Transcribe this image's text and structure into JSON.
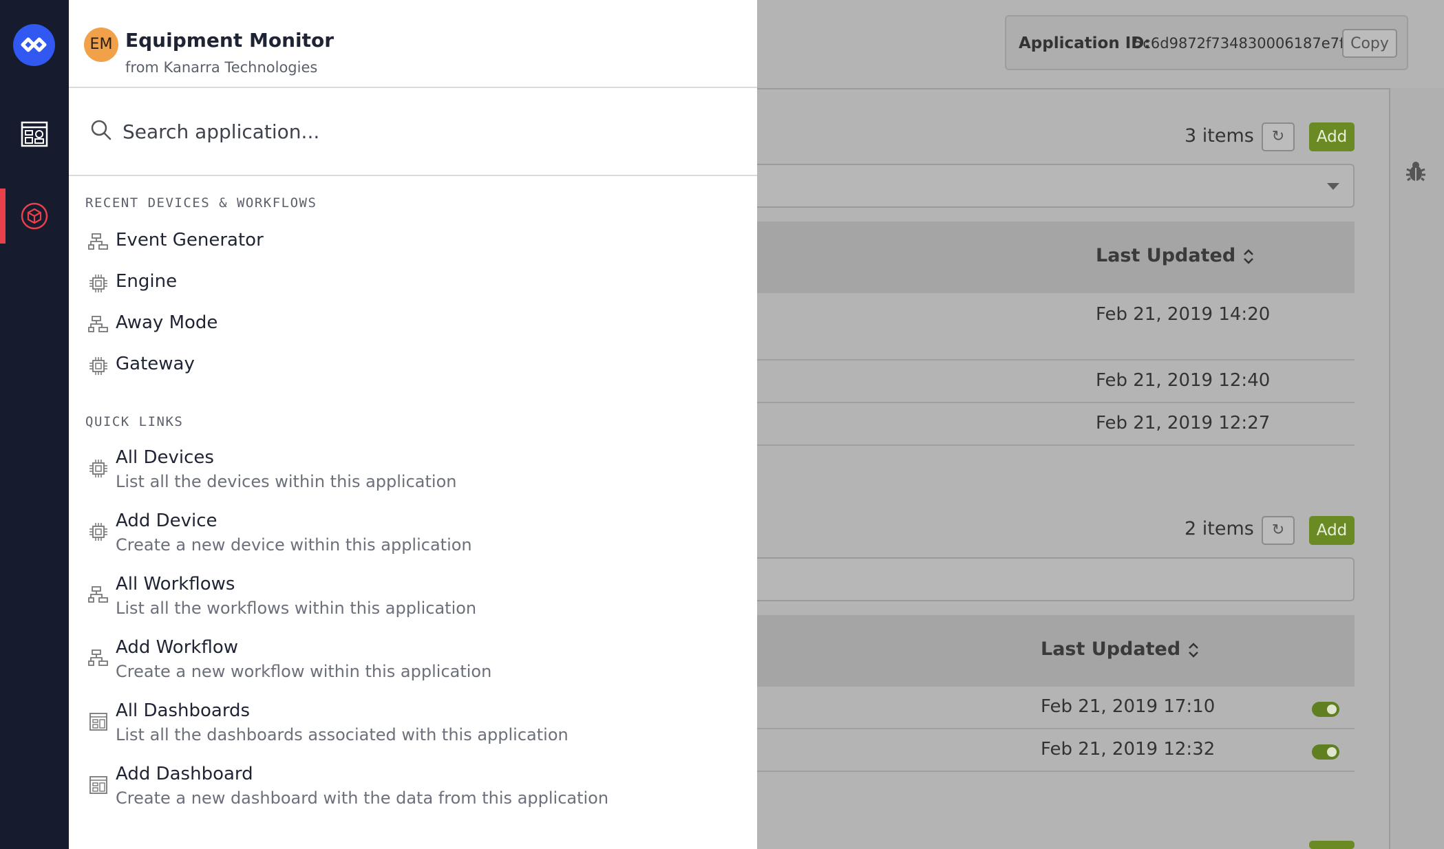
{
  "app": {
    "initials": "EM",
    "name": "Equipment Monitor",
    "org": "from Kanarra Technologies"
  },
  "search": {
    "placeholder": "Search application..."
  },
  "recent": {
    "title": "RECENT DEVICES & WORKFLOWS",
    "items": [
      {
        "label": "Event Generator",
        "icon": "workflow-icon"
      },
      {
        "label": "Engine",
        "icon": "device-chip-icon"
      },
      {
        "label": "Away Mode",
        "icon": "workflow-icon"
      },
      {
        "label": "Gateway",
        "icon": "device-chip-icon"
      }
    ]
  },
  "quick_links": {
    "title": "QUICK LINKS",
    "items": [
      {
        "label": "All Devices",
        "desc": "List all the devices within this application",
        "icon": "device-chip-icon"
      },
      {
        "label": "Add Device",
        "desc": "Create a new device within this application",
        "icon": "device-chip-icon"
      },
      {
        "label": "All Workflows",
        "desc": "List all the workflows within this application",
        "icon": "workflow-icon"
      },
      {
        "label": "Add Workflow",
        "desc": "Create a new workflow within this application",
        "icon": "workflow-icon"
      },
      {
        "label": "All Dashboards",
        "desc": "List all the dashboards associated with this application",
        "icon": "dashboard-icon"
      },
      {
        "label": "Add Dashboard",
        "desc": "Create a new dashboard with the data from this application",
        "icon": "dashboard-icon"
      }
    ]
  },
  "background": {
    "application_id_label": "Application ID:",
    "application_id": "5c6d9872f734830006187e7f",
    "copy_label": "Copy",
    "devices": {
      "count": "3 items",
      "add_label": "Add",
      "refresh_glyph": "↻",
      "column": "Last Updated",
      "rows": [
        "Feb 21, 2019 14:20",
        "Feb 21, 2019 12:40",
        "Feb 21, 2019 12:27"
      ]
    },
    "workflows": {
      "count": "2 items",
      "add_label": "Add",
      "refresh_glyph": "↻",
      "column": "Last Updated",
      "rows": [
        "Feb 21, 2019 17:10",
        "Feb 21, 2019 12:32"
      ]
    }
  },
  "colors": {
    "rail": "#161b2e",
    "brand": "#3158f0",
    "active_indicator": "#e8414c",
    "accent_green": "#6a8a24",
    "avatar": "#f0a14a"
  }
}
